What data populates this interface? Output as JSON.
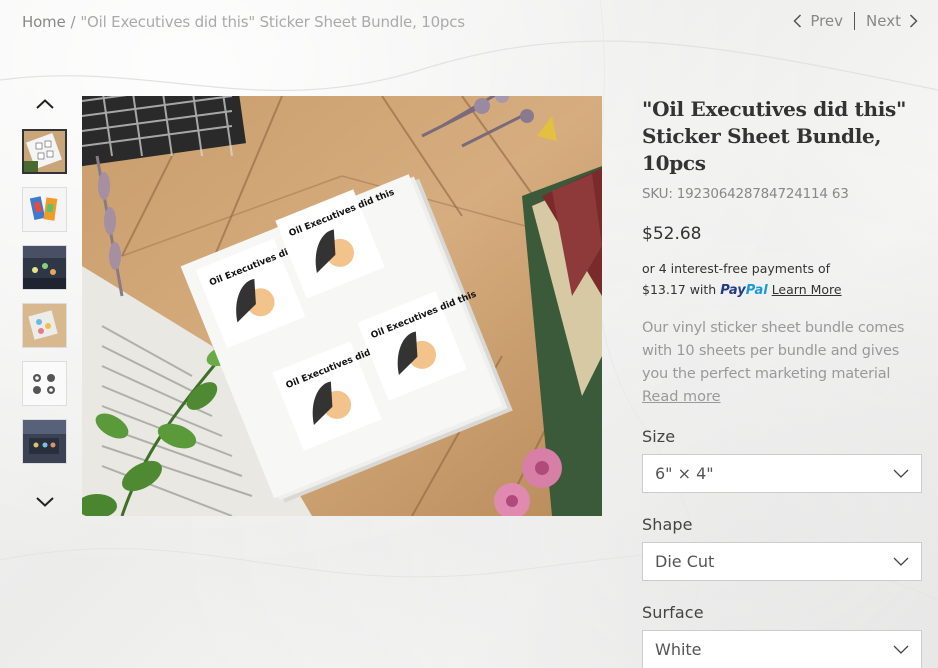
{
  "breadcrumb": {
    "home": "Home",
    "separator": "/",
    "current": "\"Oil Executives did this\" Sticker Sheet Bundle, 10pcs"
  },
  "pager": {
    "prev": "Prev",
    "next": "Next"
  },
  "sticker_text": "Oil Executives did this",
  "product": {
    "title": "\"Oil Executives did this\" Sticker Sheet Bundle, 10pcs",
    "sku": "SKU: 192306428784724114 63",
    "price": "$52.68",
    "installments_line1": "or 4 interest-free payments of",
    "installment_amount": "$13.17 with",
    "paypal_a": "Pay",
    "paypal_b": "Pal",
    "learn_more": "Learn More",
    "description": "Our vinyl sticker sheet bundle comes with 10 sheets per bundle and gives you the perfect marketing material",
    "read_more": "Read more"
  },
  "options": [
    {
      "label": "Size",
      "value": "6\" × 4\""
    },
    {
      "label": "Shape",
      "value": "Die Cut"
    },
    {
      "label": "Surface",
      "value": "White"
    }
  ],
  "colors": {
    "accent": "#333333",
    "muted": "#999999",
    "paypal_dark": "#253b80",
    "paypal_light": "#179bd7"
  }
}
